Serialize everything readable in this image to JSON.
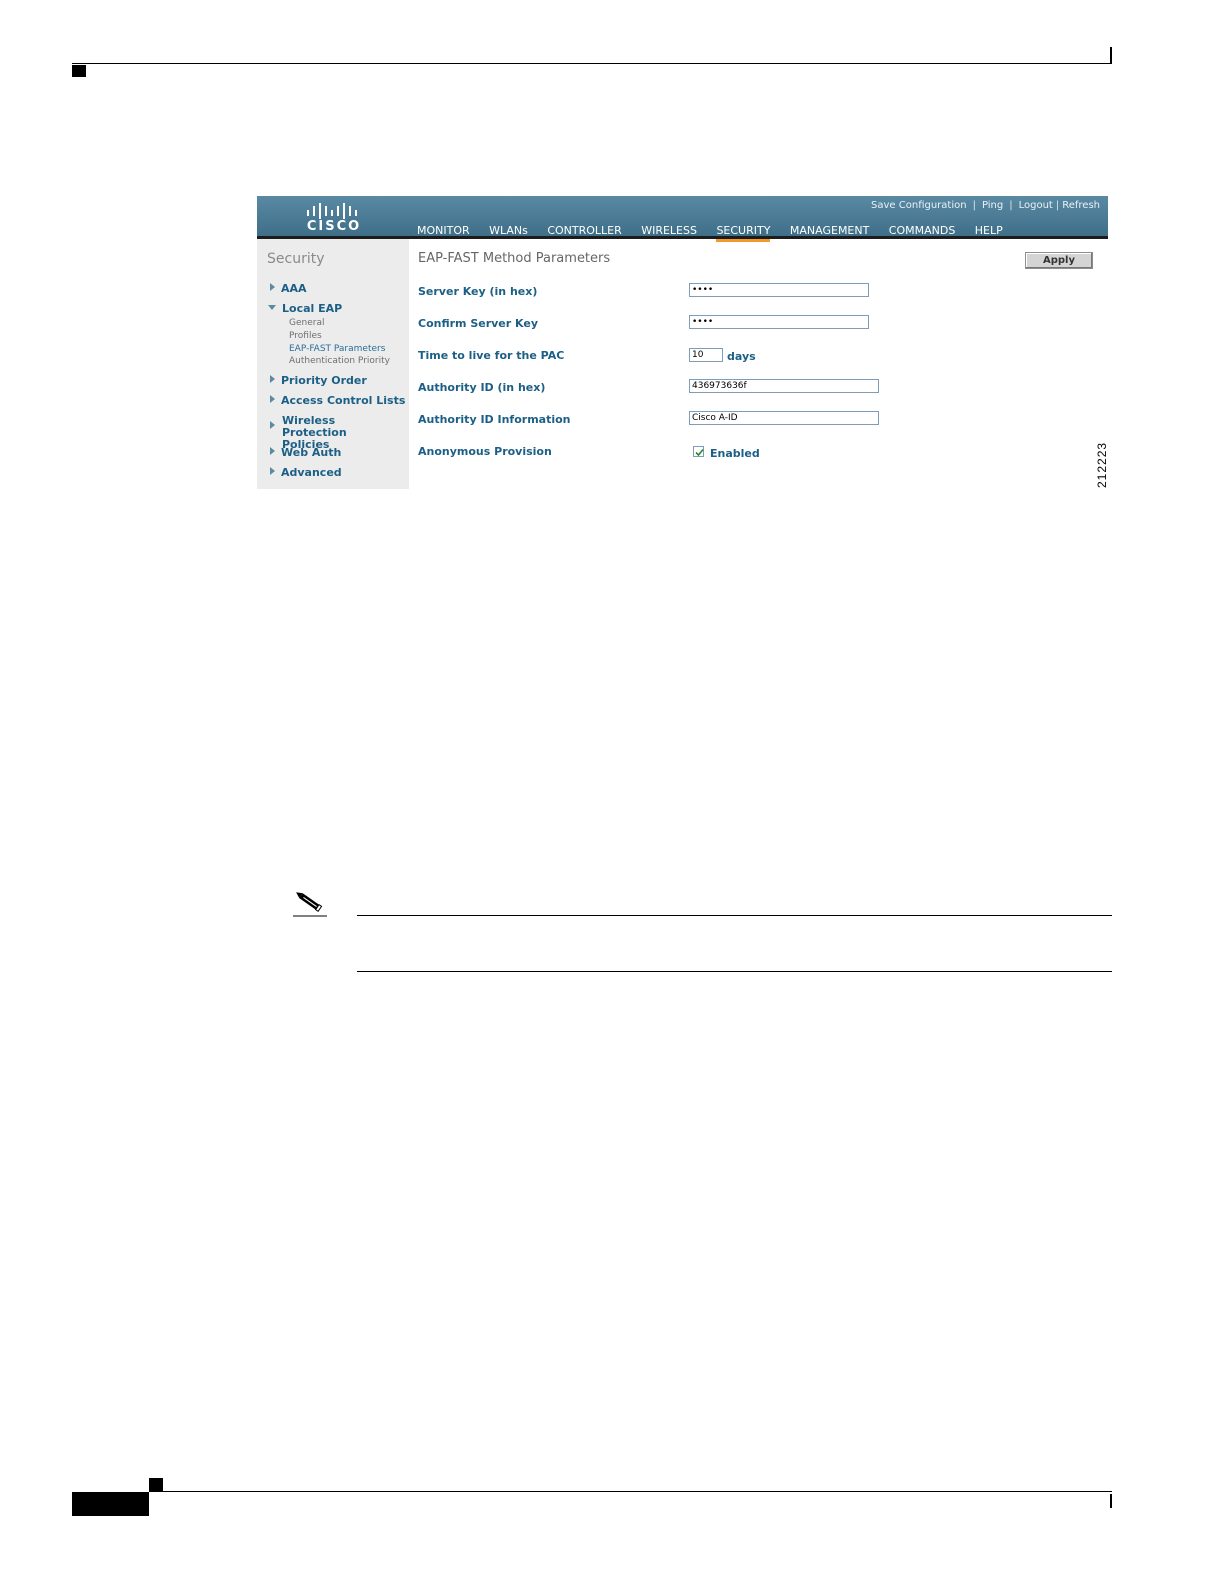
{
  "screenshot": {
    "logo_text": "CISCO",
    "utility_links": [
      "Save Configuration",
      "Ping",
      "Logout",
      "Refresh"
    ],
    "tabs": [
      "MONITOR",
      "WLANs",
      "CONTROLLER",
      "WIRELESS",
      "SECURITY",
      "MANAGEMENT",
      "COMMANDS",
      "HELP"
    ],
    "active_tab": "SECURITY",
    "sidebar": {
      "title": "Security",
      "items": [
        "AAA",
        "Local EAP",
        "Priority Order",
        "Access Control Lists",
        "Wireless Protection Policies",
        "Web Auth",
        "Advanced"
      ],
      "local_eap_sub": [
        "General",
        "Profiles",
        "EAP-FAST Parameters",
        "Authentication Priority"
      ]
    },
    "page_title": "EAP-FAST Method Parameters",
    "apply_label": "Apply",
    "fields": {
      "server_key_label": "Server Key (in hex)",
      "server_key_value": "••••",
      "confirm_key_label": "Confirm Server Key",
      "confirm_key_value": "••••",
      "ttl_label": "Time to live for the PAC",
      "ttl_value": "10",
      "ttl_unit": "days",
      "authority_id_label": "Authority ID (in hex)",
      "authority_id_value": "436973636f",
      "authority_info_label": "Authority ID Information",
      "authority_info_value": "Cisco A-ID",
      "anon_label": "Anonymous Provision",
      "anon_checkbox_label": "Enabled"
    }
  },
  "figure_number": "212223",
  "colors": {
    "header_blue": "#4d7f99",
    "active_tab_underline": "#f29a2c",
    "label_blue": "#1c5f86"
  }
}
